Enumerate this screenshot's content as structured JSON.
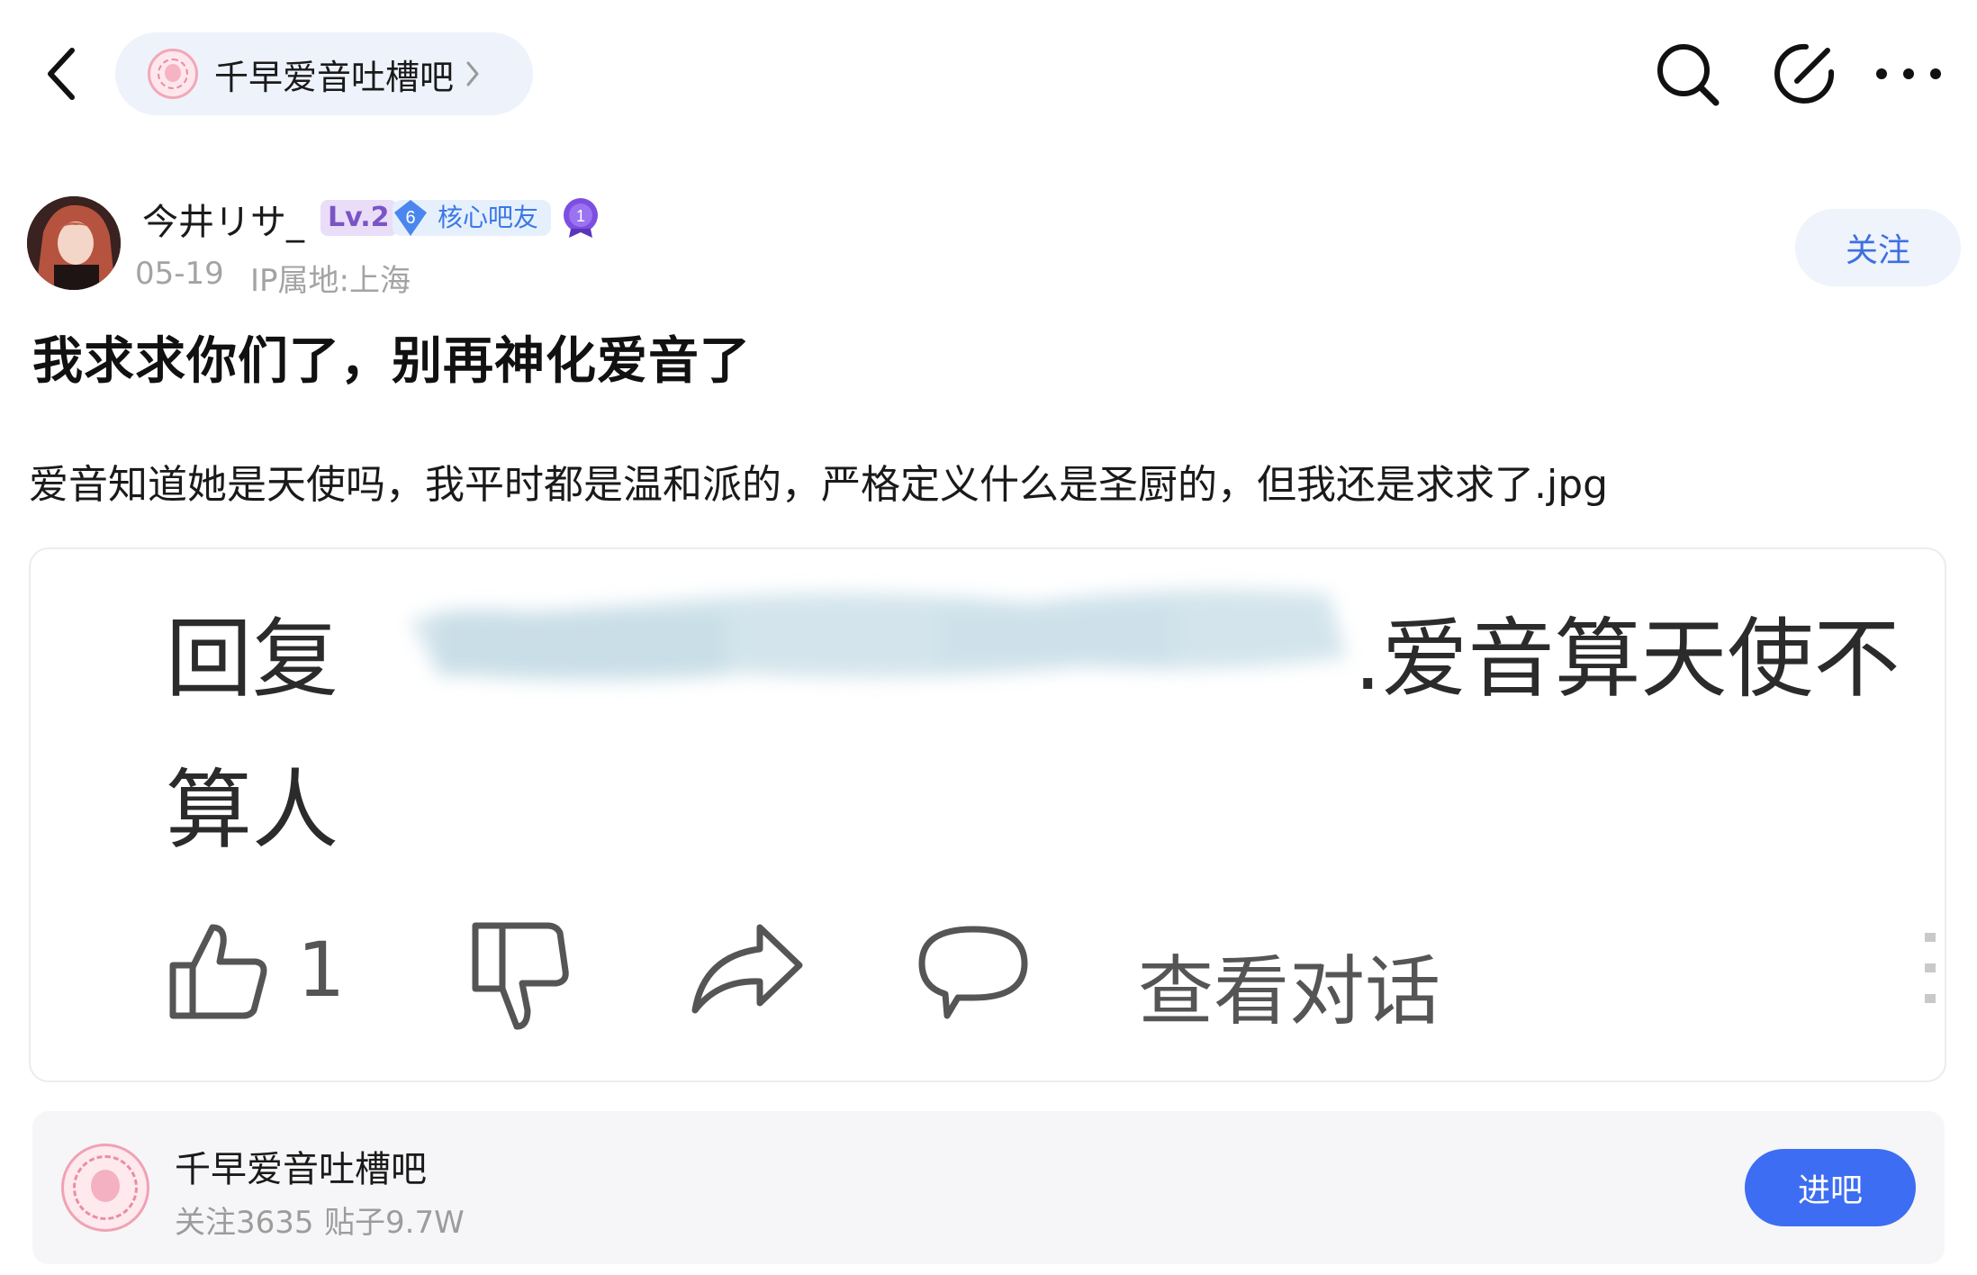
{
  "top_bar": {
    "back_icon": "chevron-left-icon",
    "forum_name": "千早爱音吐槽吧",
    "forum_chevron_icon": "chevron-right-icon",
    "search_icon": "search-icon",
    "edit_icon": "edit-icon",
    "more_icon": "more-horizontal-icon"
  },
  "author": {
    "name": "今井リサ_",
    "level": "Lv.2",
    "core_level": "6",
    "core_badge": "核心吧友",
    "medal_number": "1",
    "date": "05-19",
    "ip_location": "IP属地:上海",
    "follow_label": "关注"
  },
  "post": {
    "title": "我求求你们了，别再神化爱音了",
    "body": "爱音知道她是天使吗，我平时都是温和派的，严格定义什么是圣厨的，但我还是求求了.jpg",
    "image": {
      "reply_prefix": "回复",
      "reply_text": ".爱音算天使不",
      "reply_text_line2": "算人",
      "like_count": "1",
      "view_dialog": "查看对话"
    }
  },
  "forum_card": {
    "name": "千早爱音吐槽吧",
    "followers": "关注3635",
    "posts": "贴子9.7W",
    "enter_label": "进吧"
  },
  "colors": {
    "accent": "#3d6df2",
    "follow_text": "#3f6fe0",
    "level_badge_bg": "#e9ddf8",
    "core_badge_bg": "#e6f0fd",
    "meta_gray": "#a3a3a3"
  }
}
